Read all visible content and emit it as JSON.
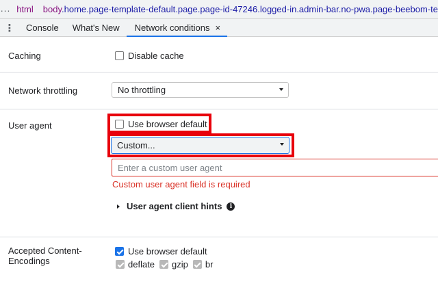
{
  "breadcrumb": {
    "more_label": "...",
    "html_tag": "html",
    "body_tag": "body",
    "body_classes": ".home.page-template-default.page.page-id-47246.logged-in.admin-bar.no-pwa.page-beebom-te"
  },
  "tabs": {
    "menu_label": "⋮",
    "items": [
      {
        "label": "Console"
      },
      {
        "label": "What's New"
      },
      {
        "label": "Network conditions"
      }
    ],
    "close_label": "×",
    "active_color": "#1a73e8"
  },
  "caching": {
    "label": "Caching",
    "disable_cache_label": "Disable cache",
    "disable_cache_checked": false
  },
  "throttling": {
    "label": "Network throttling",
    "selected": "No throttling"
  },
  "user_agent": {
    "label": "User agent",
    "use_default_label": "Use browser default",
    "use_default_checked": false,
    "selected": "Custom...",
    "input_placeholder": "Enter a custom user agent",
    "error_message": "Custom user agent field is required",
    "client_hints_label": "User agent client hints",
    "info_icon": "info-icon",
    "error_color": "#d93025",
    "highlight_color": "#e8000b"
  },
  "encodings": {
    "label_line1": "Accepted Content-",
    "label_line2": "Encodings",
    "use_default_label": "Use browser default",
    "use_default_checked": true,
    "options": [
      {
        "label": "deflate",
        "checked": true
      },
      {
        "label": "gzip",
        "checked": true
      },
      {
        "label": "br",
        "checked": true
      }
    ]
  }
}
